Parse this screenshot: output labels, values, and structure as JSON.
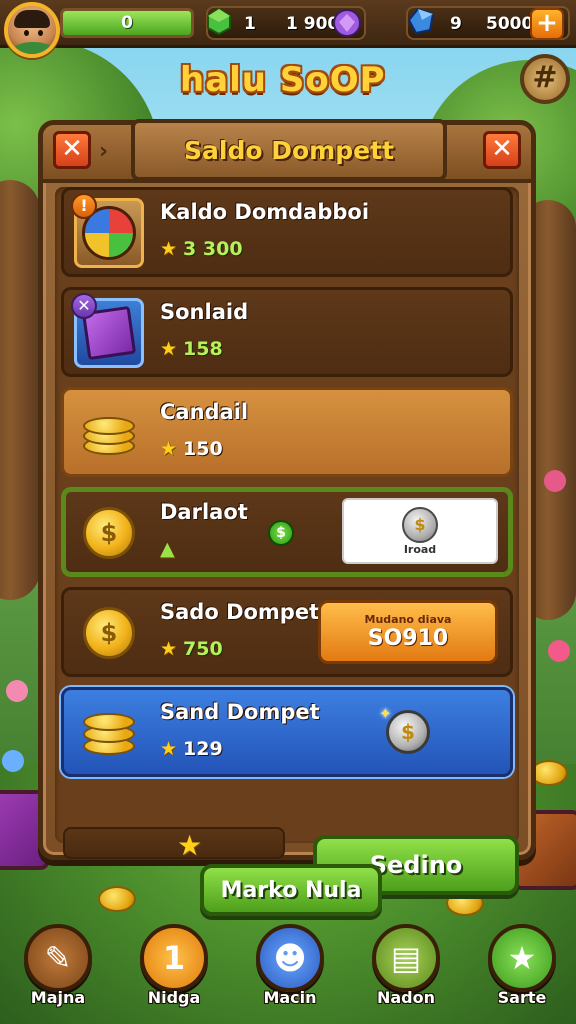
{
  "hud": {
    "xp_value": "0",
    "xp_fill_fraction": 1.0,
    "res1_count": "1",
    "res1_amount": "1 900",
    "res2_count": "9",
    "res2_amount": "5000",
    "plus_label": "+"
  },
  "game_title": "halu SoOP",
  "settings_icon": "#",
  "panel": {
    "title": "Saldo Dompett",
    "close_label": "✕",
    "arrow_label": "›"
  },
  "items": [
    {
      "name": "Kaldo Domdabboi",
      "price": "3 300",
      "badge": "!"
    },
    {
      "name": "Sonlaid",
      "price": "158",
      "badge": "✕"
    },
    {
      "name": "Candail",
      "price": "150"
    },
    {
      "name": "Darlaot",
      "price": "",
      "card_label": "Iroad"
    },
    {
      "name": "Sado Dompet",
      "price": "750",
      "buy_sub": "Mudano diava",
      "buy_main": "SO910"
    },
    {
      "name": "Sand Dompet",
      "price": "129"
    }
  ],
  "send_button": "Sedino",
  "market_button": "Marko Nula",
  "nav": [
    {
      "label": "Majna",
      "color": "#a05a28",
      "icon": "✎"
    },
    {
      "label": "Nidga",
      "color": "#f2a11a",
      "icon": "1"
    },
    {
      "label": "Macin",
      "color": "#3a6fd6",
      "icon": "☻"
    },
    {
      "label": "Nadon",
      "color": "#6a9a2a",
      "icon": "▤"
    },
    {
      "label": "Sarte",
      "color": "#5aa82a",
      "icon": "★"
    }
  ],
  "colors": {
    "accent": "#ffd23a",
    "primary_green": "#4e9f1c",
    "panel_brown": "#7c4e25",
    "highlight_blue": "#2454b8"
  }
}
